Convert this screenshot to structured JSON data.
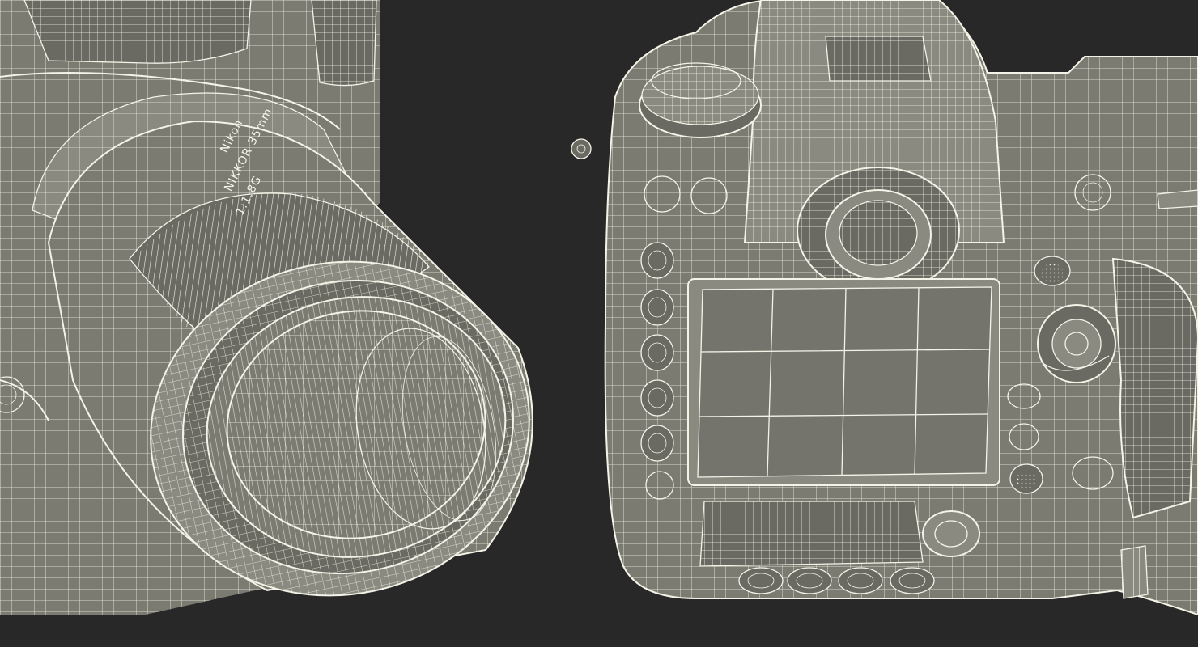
{
  "scene": {
    "background_color": "#282828",
    "wire_color": "#f4f3e8",
    "surface_color": "#7b7b71",
    "left_view": {
      "subject": "camera-lens-front-wireframe",
      "lens_text_1": "Nikon",
      "lens_text_2": "NIKKOR 35mm",
      "lens_text_3": "1:1.8G"
    },
    "right_view": {
      "subject": "camera-back-wireframe"
    }
  }
}
